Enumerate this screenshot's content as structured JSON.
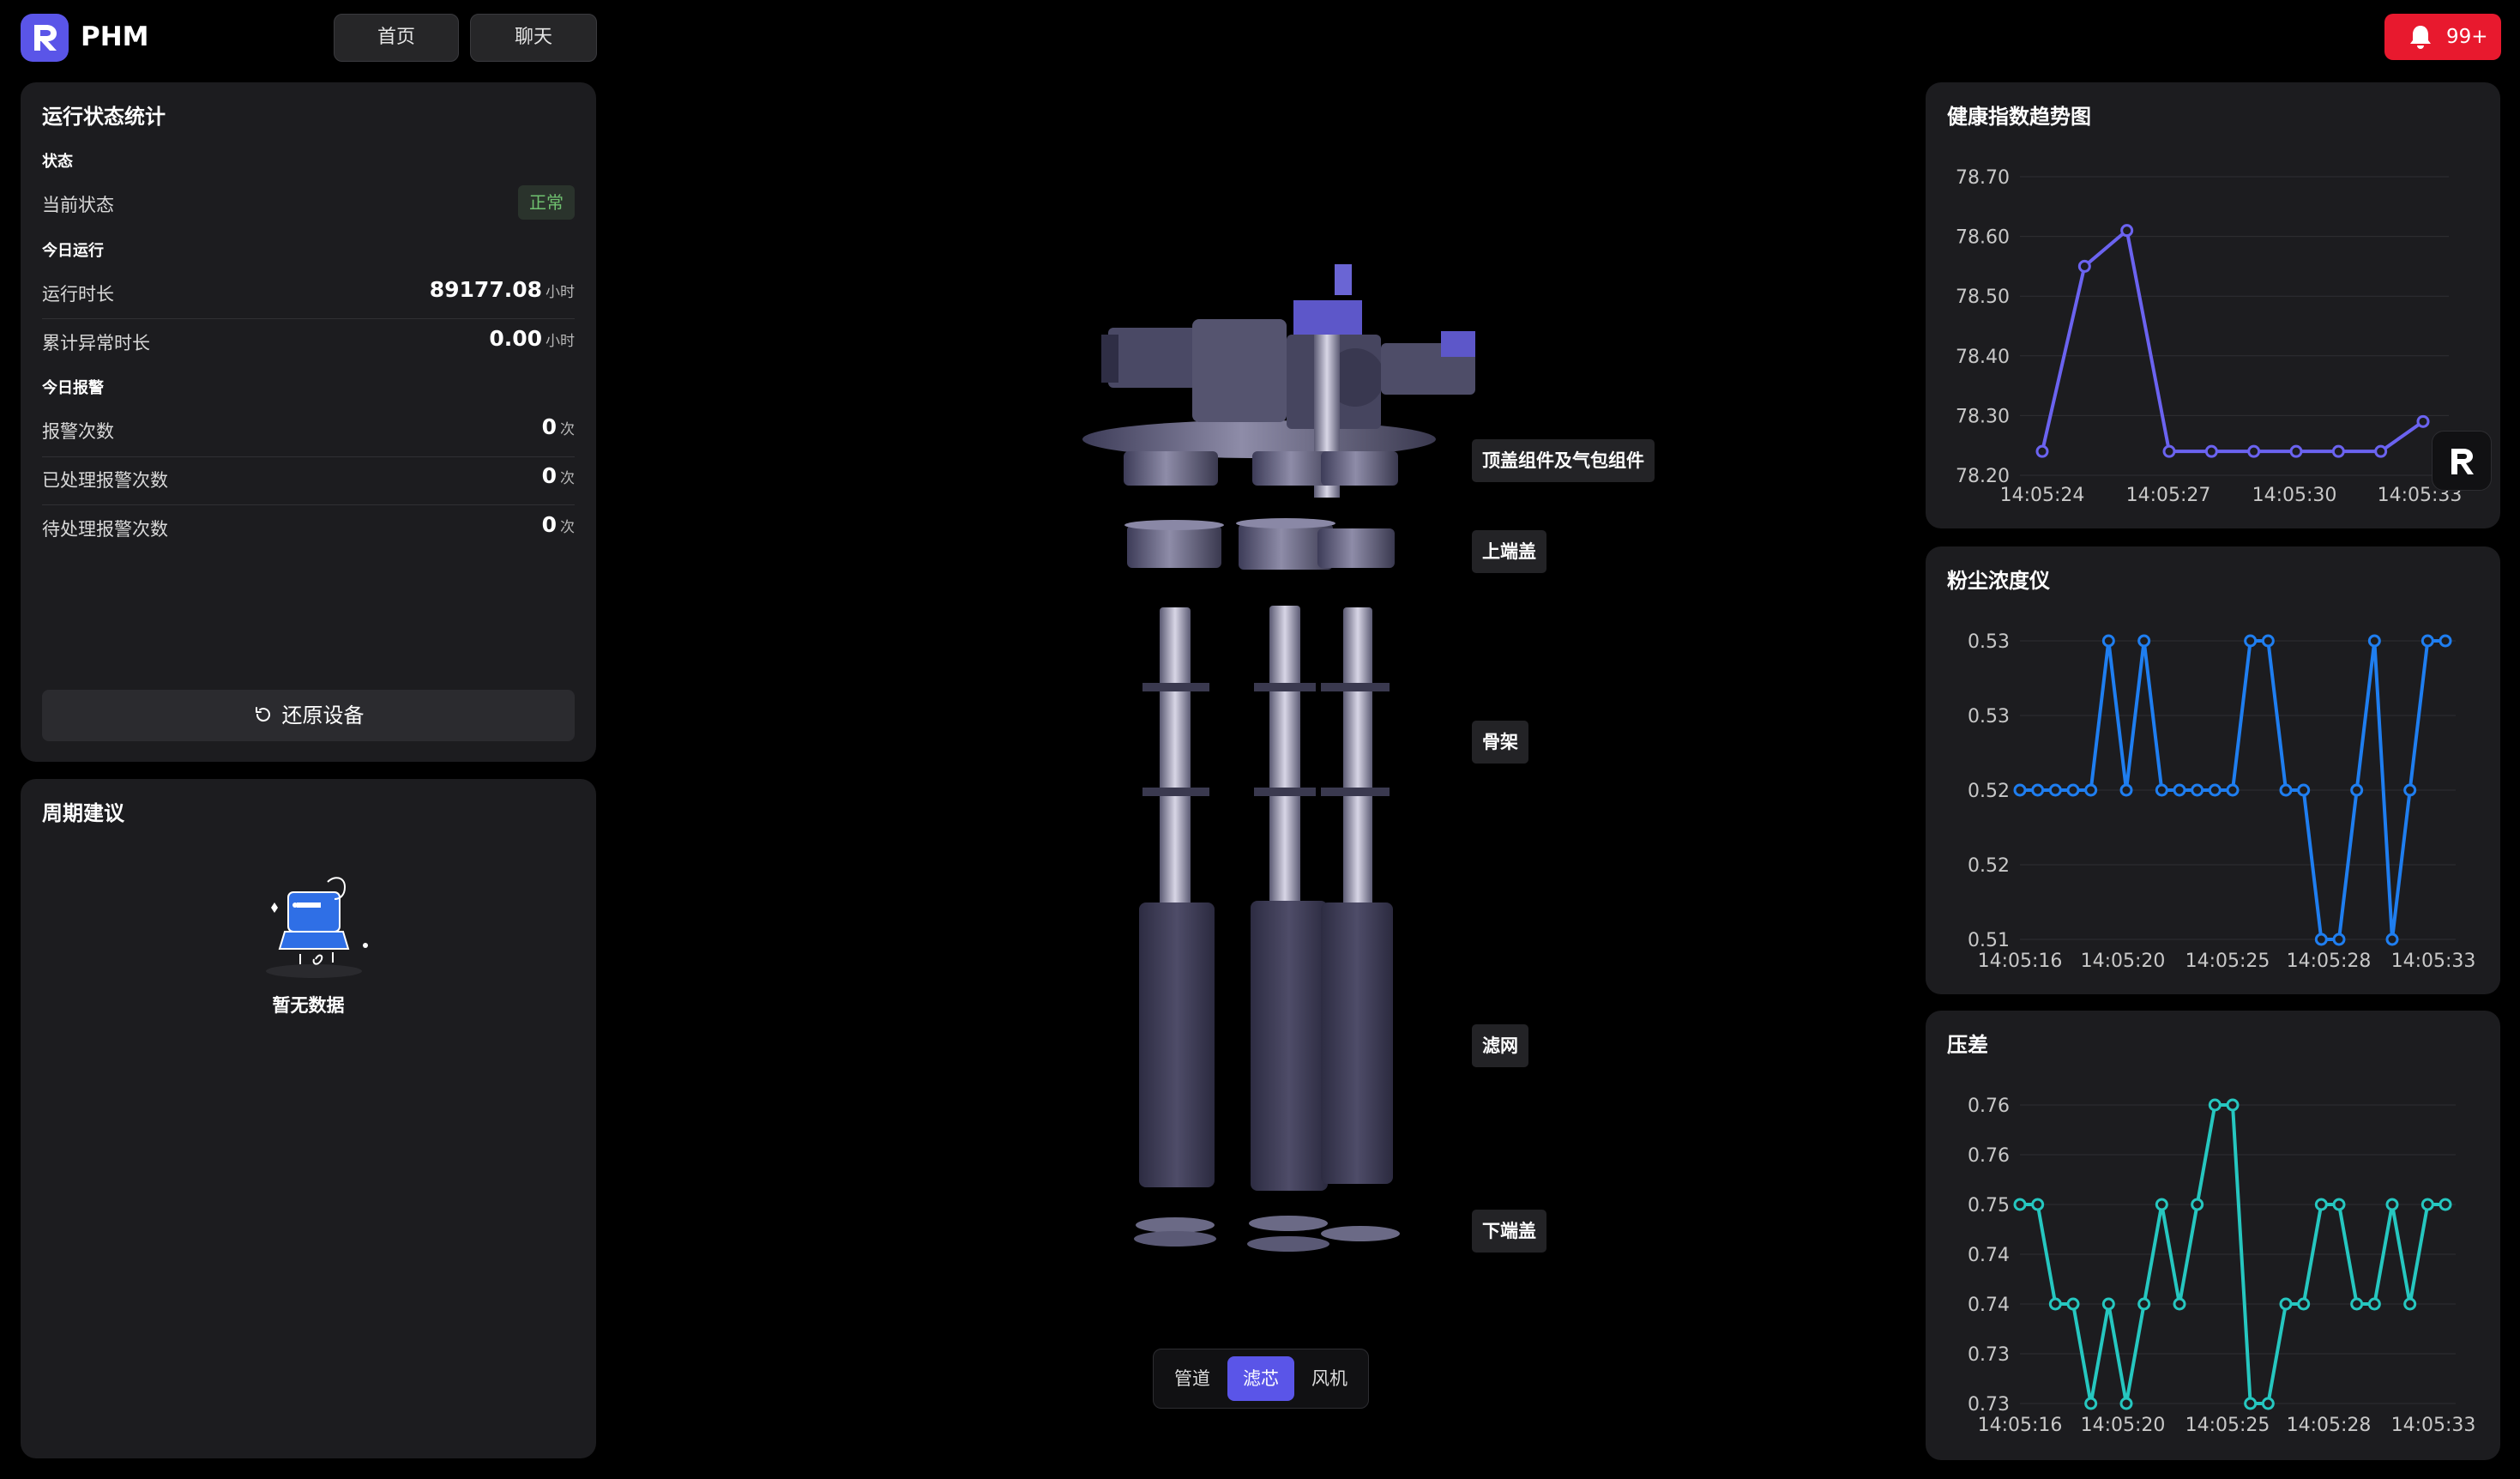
{
  "app": {
    "name": "PHM"
  },
  "nav": {
    "home": "首页",
    "chat": "聊天"
  },
  "notifications": {
    "count": "99+"
  },
  "status_panel": {
    "title": "运行状态统计",
    "group_status": "状态",
    "current_status_label": "当前状态",
    "current_status_value": "正常",
    "group_today_run": "今日运行",
    "run_time_label": "运行时长",
    "run_time_value": "89177.08",
    "run_time_unit": "小时",
    "abnormal_time_label": "累计异常时长",
    "abnormal_time_value": "0.00",
    "abnormal_time_unit": "小时",
    "group_today_alarm": "今日报警",
    "alarm_count_label": "报警次数",
    "alarm_count_value": "0",
    "handled_label": "已处理报警次数",
    "handled_value": "0",
    "pending_label": "待处理报警次数",
    "pending_value": "0",
    "count_unit": "次",
    "restore_button": "还原设备"
  },
  "advice_panel": {
    "title": "周期建议",
    "empty_text": "暂无数据"
  },
  "model": {
    "labels": {
      "top_cover": "顶盖组件及气包组件",
      "upper_cap": "上端盖",
      "frame": "骨架",
      "filter": "滤网",
      "lower_cap": "下端盖"
    },
    "tabs": [
      "管道",
      "滤芯",
      "风机"
    ],
    "active_tab": "滤芯"
  },
  "colors": {
    "accent": "#5a55e8",
    "health_line": "#6b63f0",
    "dust_line": "#1f7ef0",
    "pressure_line": "#26c7c0",
    "alarm": "#e8192e",
    "status_ok": "#6fc06f"
  },
  "chart_data": [
    {
      "type": "line",
      "title": "健康指数趋势图",
      "x_ticks": [
        "14:05:24",
        "14:05:27",
        "14:05:30",
        "14:05:33"
      ],
      "y_ticks": [
        "78.20",
        "78.30",
        "78.40",
        "78.50",
        "78.60",
        "78.70"
      ],
      "ylim": [
        78.2,
        78.7
      ],
      "grid": true,
      "series": [
        {
          "values": [
            78.24,
            78.55,
            78.61,
            78.24,
            78.24,
            78.24,
            78.24,
            78.24,
            78.24,
            78.29
          ]
        }
      ]
    },
    {
      "type": "line",
      "title": "粉尘浓度仪",
      "x_ticks": [
        "14:05:16",
        "14:05:20",
        "14:05:25",
        "14:05:28",
        "14:05:33"
      ],
      "y_ticks": [
        "0.51",
        "0.52",
        "0.52",
        "0.53",
        "0.53"
      ],
      "ylim": [
        0.512,
        0.532
      ],
      "grid": true,
      "series": [
        {
          "values": [
            0.522,
            0.522,
            0.522,
            0.522,
            0.522,
            0.532,
            0.522,
            0.532,
            0.522,
            0.522,
            0.522,
            0.522,
            0.522,
            0.532,
            0.532,
            0.522,
            0.522,
            0.512,
            0.512,
            0.522,
            0.532,
            0.512,
            0.522,
            0.532,
            0.532
          ]
        }
      ]
    },
    {
      "type": "line",
      "title": "压差",
      "x_ticks": [
        "14:05:16",
        "14:05:20",
        "14:05:25",
        "14:05:28",
        "14:05:33"
      ],
      "y_ticks": [
        "0.73",
        "0.73",
        "0.74",
        "0.74",
        "0.75",
        "0.76",
        "0.76"
      ],
      "ylim": [
        0.728,
        0.764
      ],
      "grid": true,
      "series": [
        {
          "values": [
            0.752,
            0.752,
            0.74,
            0.74,
            0.728,
            0.74,
            0.728,
            0.74,
            0.752,
            0.74,
            0.752,
            0.764,
            0.764,
            0.728,
            0.728,
            0.74,
            0.74,
            0.752,
            0.752,
            0.74,
            0.74,
            0.752,
            0.74,
            0.752,
            0.752
          ]
        }
      ]
    }
  ]
}
